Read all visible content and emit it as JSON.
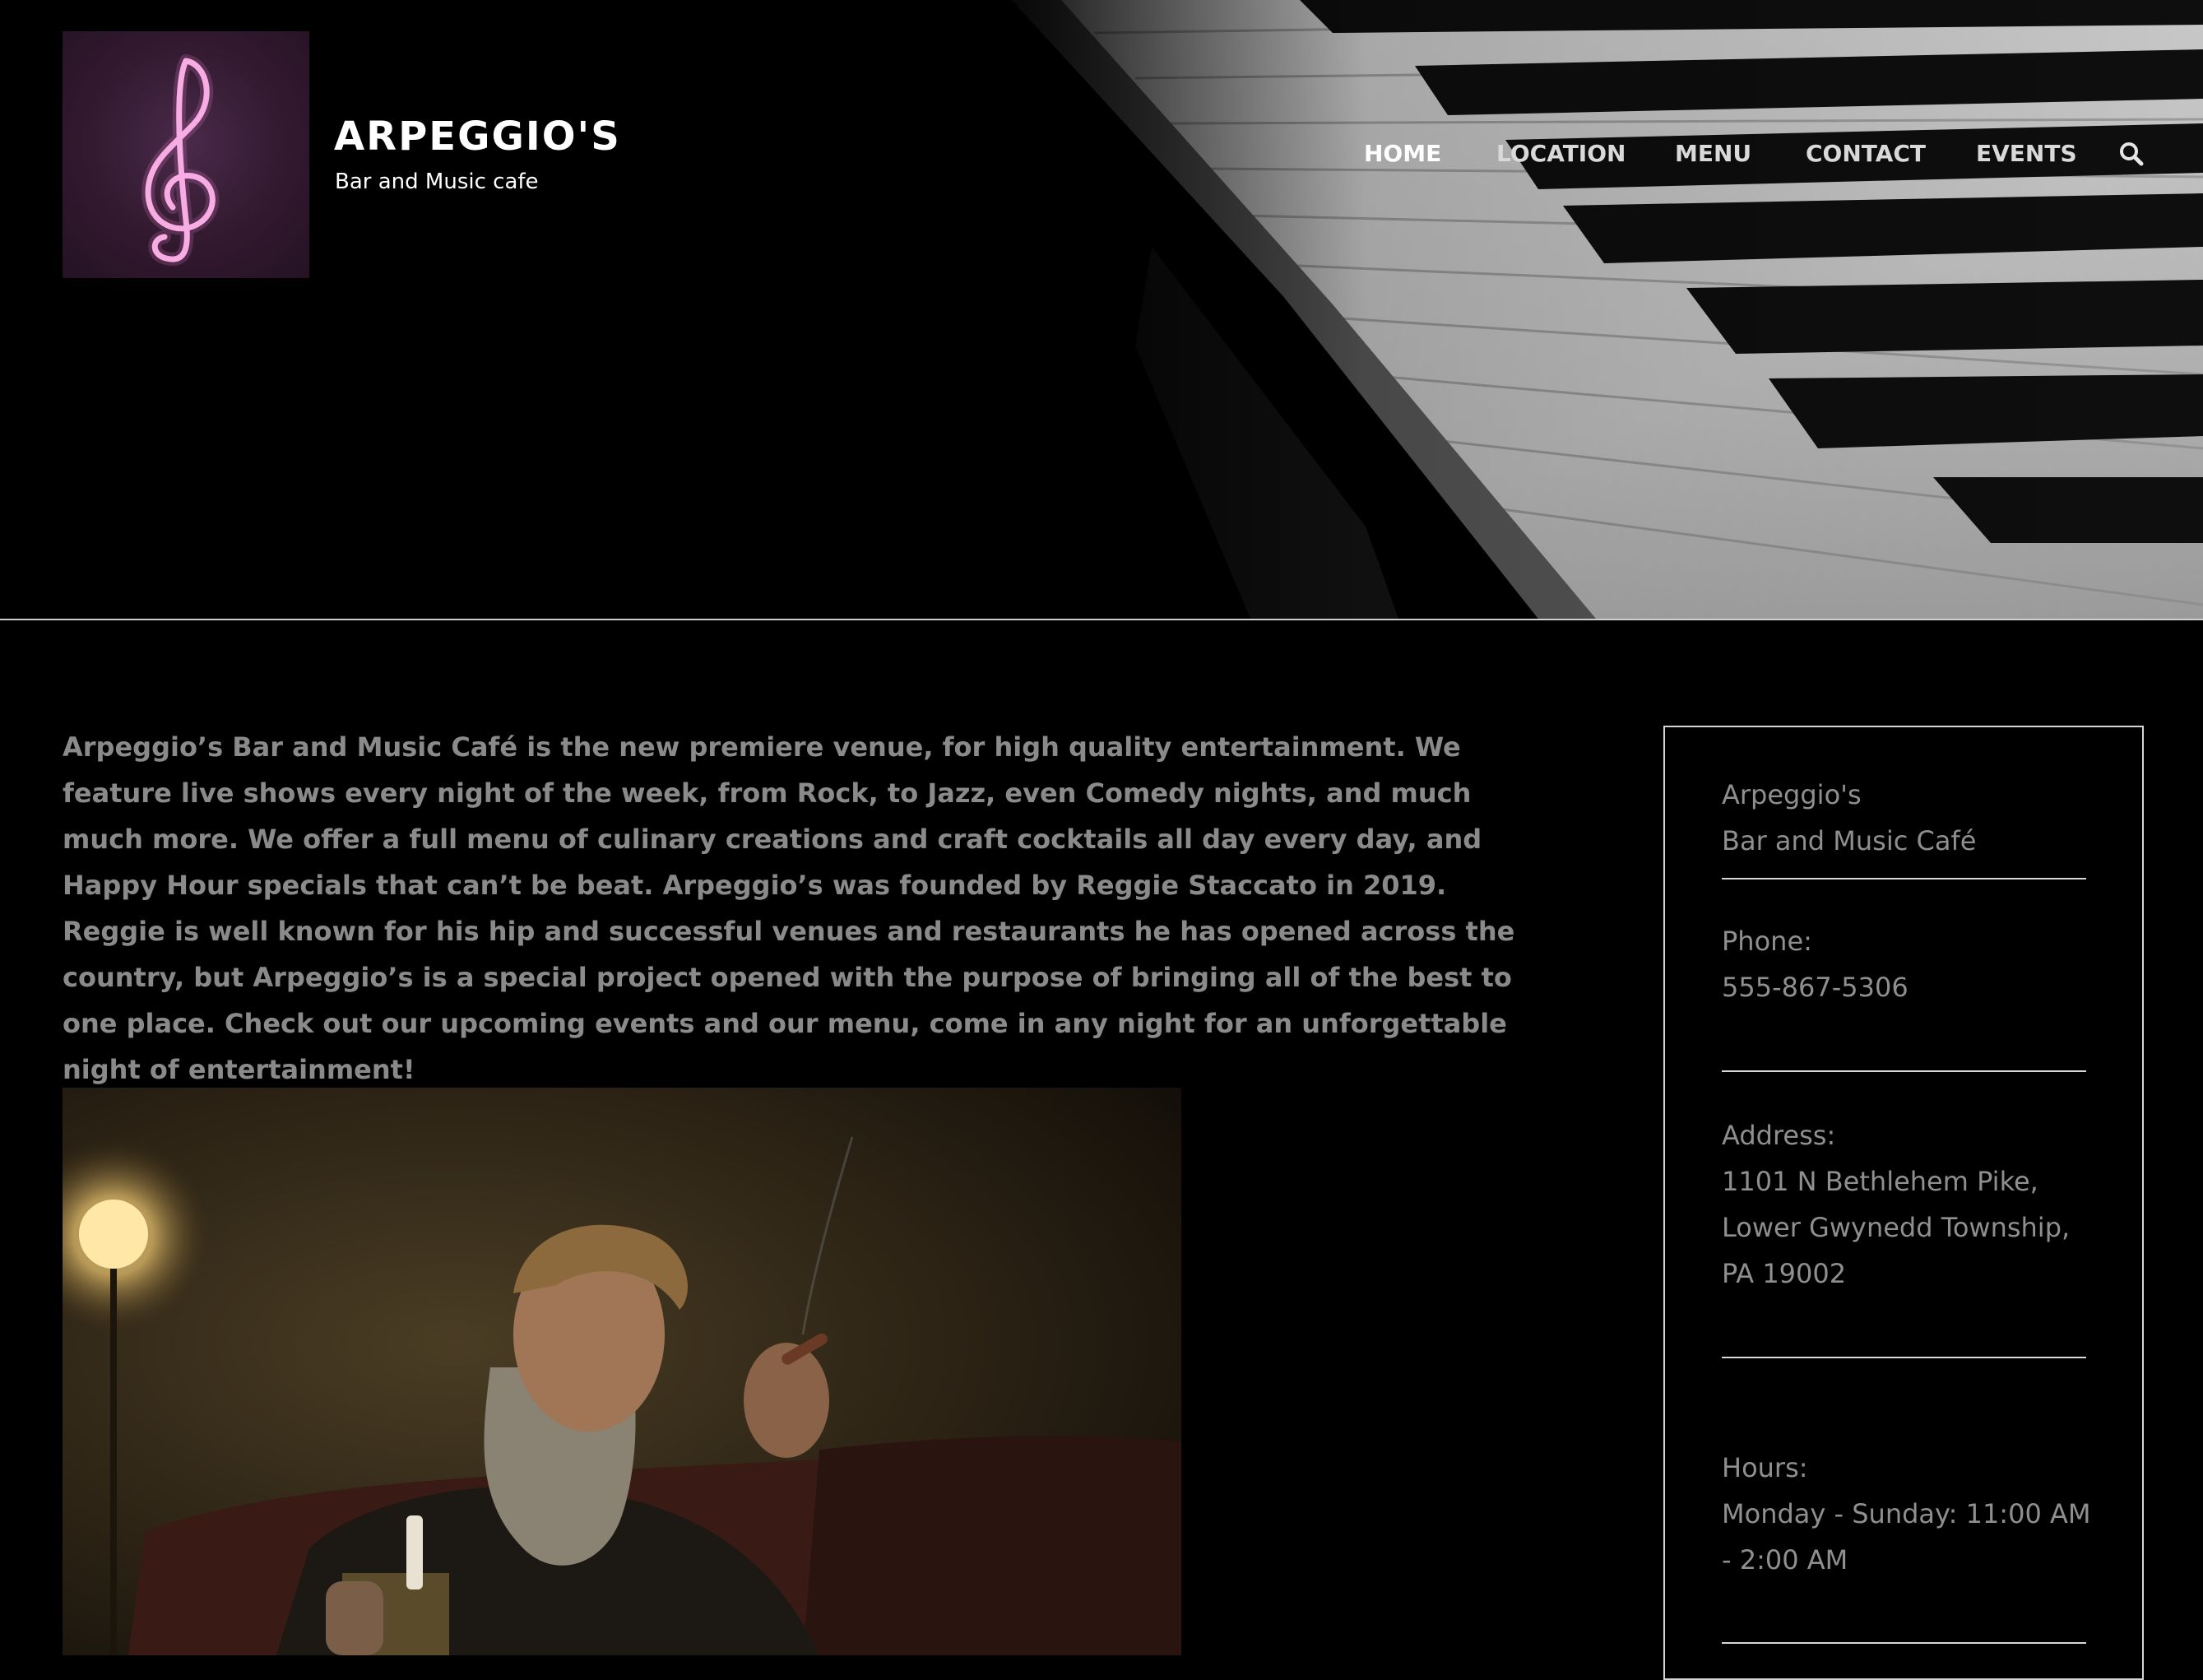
{
  "site": {
    "title": "ARPEGGIO'S",
    "tagline": "Bar and Music cafe"
  },
  "nav": {
    "items": [
      {
        "label": "HOME",
        "active": true
      },
      {
        "label": "LOCATION",
        "active": false
      },
      {
        "label": "MENU",
        "active": false
      },
      {
        "label": "CONTACT",
        "active": false
      },
      {
        "label": "EVENTS",
        "active": false
      }
    ],
    "search_icon": "search-icon"
  },
  "main": {
    "intro": "Arpeggio’s Bar and Music Café is the new premiere venue, for high quality entertainment. We feature live shows every night of the week, from Rock, to Jazz, even Comedy nights, and much much more. We offer a full menu of culinary creations and craft cocktails all day every day, and Happy Hour specials that can’t be beat. Arpeggio’s was founded by Reggie Staccato in 2019. Reggie is well known for his hip and successful venues and restaurants he has opened across the country, but Arpeggio’s is a special project opened with the purpose of bringing all of the best to one place. Check out our upcoming events and our menu, come in any night for an unforgettable night of entertainment!"
  },
  "info": {
    "name_line1": "Arpeggio's",
    "name_line2": "Bar and Music Café",
    "phone_label": "Phone:",
    "phone": "555-867-5306",
    "address_label": "Address:",
    "address_line1": "1101 N Bethlehem Pike,",
    "address_line2": "Lower Gwynedd Township,",
    "address_line3": "PA 19002",
    "hours_label": "Hours:",
    "hours_line1": "Monday - Sunday: 11:00 AM",
    "hours_line2": "- 2:00 AM"
  },
  "colors": {
    "background": "#000000",
    "logo_bg": "#32192f",
    "neon_pink": "#f7b3e6",
    "body_text": "#8a8a8a",
    "rule": "#d8d8d8"
  }
}
